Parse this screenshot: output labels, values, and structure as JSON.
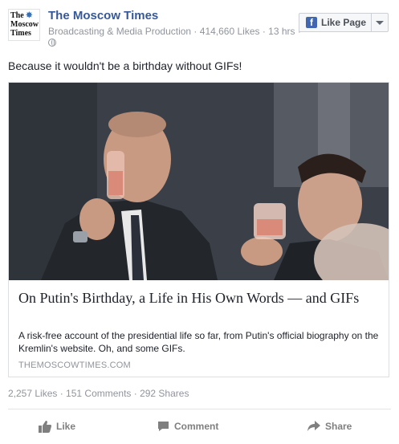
{
  "post": {
    "logo_text_line1": "The",
    "logo_text_line2": "Moscow",
    "logo_text_line3": "Times",
    "page_name": "The Moscow Times",
    "meta": "Broadcasting & Media Production · 414,660 Likes · 13 hrs ·",
    "like_page_label": "Like Page",
    "message": "Because it wouldn't be a birthday without GIFs!",
    "link": {
      "title": "On Putin's Birthday, a Life in His Own Words — and GIFs",
      "description": "A risk-free account of the presidential life so far, from Putin's official biography on the Kremlin's website. Oh, and some GIFs.",
      "domain": "THEMOSCOWTIMES.COM"
    },
    "stats": "2,257 Likes · 151 Comments · 292 Shares",
    "actions": {
      "like": "Like",
      "comment": "Comment",
      "share": "Share"
    }
  },
  "icons": {
    "logo": "moscow-times-logo",
    "privacy": "globe-icon",
    "facebook": "facebook-f-icon",
    "dropdown": "chevron-down-icon",
    "like": "thumbs-up-icon",
    "comment": "speech-bubble-icon",
    "share": "share-arrow-icon"
  },
  "colors": {
    "link_blue": "#365899",
    "facebook_blue": "#4267b2",
    "meta_grey": "#90949c",
    "action_grey": "#7f7f7f"
  }
}
